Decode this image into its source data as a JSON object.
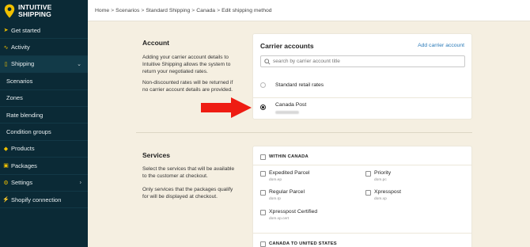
{
  "brand": {
    "line1": "INTUITIVE",
    "line2": "SHIPPING",
    "accent": "#f0c000",
    "sidebar_bg": "#0b2a36"
  },
  "sidebar": {
    "items": [
      {
        "label": "Get started",
        "icon": "rocket-icon"
      },
      {
        "label": "Activity",
        "icon": "activity-icon"
      },
      {
        "label": "Shipping",
        "icon": "truck-icon"
      },
      {
        "label": "Scenarios"
      },
      {
        "label": "Zones"
      },
      {
        "label": "Rate blending"
      },
      {
        "label": "Condition groups"
      },
      {
        "label": "Products",
        "icon": "tag-icon"
      },
      {
        "label": "Packages",
        "icon": "box-icon"
      },
      {
        "label": "Settings",
        "icon": "gear-icon"
      },
      {
        "label": "Shopify connection",
        "icon": "plug-icon"
      }
    ]
  },
  "breadcrumb": [
    "Home",
    "Scenarios",
    "Standard Shipping",
    "Canada",
    "Edit shipping method"
  ],
  "account": {
    "title": "Account",
    "desc1": "Adding your carrier account details to Intuitive Shipping allows the system to return your negotiated rates.",
    "desc2": "Non-discounted rates will be returned if no carrier account details are provided."
  },
  "carrier_card": {
    "title": "Carrier accounts",
    "add_link": "Add carrier account",
    "search_placeholder": "search by carrier account title",
    "options": [
      {
        "label": "Standard retail rates",
        "checked": false
      },
      {
        "label": "Canada Post",
        "checked": true
      }
    ]
  },
  "services": {
    "title": "Services",
    "desc1": "Select the services that will be available to the customer at checkout.",
    "desc2": "Only services that the packages qualify for will be displayed at checkout.",
    "groups": [
      {
        "label": "WITHIN CANADA",
        "items": [
          {
            "label": "Expedited Parcel",
            "code": "dom.ep"
          },
          {
            "label": "Priority",
            "code": "dom.pc"
          },
          {
            "label": "Regular Parcel",
            "code": "dom.rp"
          },
          {
            "label": "Xpresspost",
            "code": "dom.xp"
          },
          {
            "label": "Xpresspost Certified",
            "code": "dom.xp.cert"
          }
        ]
      },
      {
        "label": "CANADA TO UNITED STATES",
        "items": []
      }
    ]
  }
}
